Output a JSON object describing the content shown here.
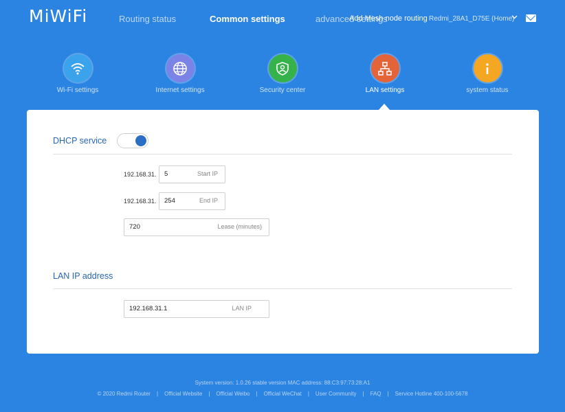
{
  "header": {
    "logo": "MiWiFi",
    "nav": {
      "routing_status": "Routing status",
      "common_settings": "Common settings",
      "advanced_settings": "advanced settings",
      "mesh": "Add Mesh node routing",
      "device": "Redmi_28A1_D75E (Home)"
    }
  },
  "features": [
    {
      "label": "Wi-Fi settings",
      "icon": "wifi-icon",
      "color": "#3aa3ec"
    },
    {
      "label": "Internet settings",
      "icon": "globe-icon",
      "color": "#7b83e6"
    },
    {
      "label": "Security center",
      "icon": "shield-icon",
      "color": "#35b34a"
    },
    {
      "label": "LAN settings",
      "icon": "network-icon",
      "color": "#e4643a"
    },
    {
      "label": "system status",
      "icon": "info-icon",
      "color": "#f5a623"
    }
  ],
  "dhcp": {
    "title": "DHCP service",
    "enabled": true,
    "prefix": "192.168.31.",
    "start_ip": {
      "value": "5",
      "placeholder": "Start IP"
    },
    "end_ip": {
      "value": "254",
      "placeholder": "End IP"
    },
    "lease": {
      "value": "720",
      "placeholder": "Lease (minutes)"
    }
  },
  "lan": {
    "title": "LAN IP address",
    "lan_ip": {
      "value": "192.168.31.1",
      "placeholder": "LAN IP"
    }
  },
  "footer": {
    "system": "System version: 1.0.26 stable version MAC address: 88:C3:97:73:28:A1",
    "links": [
      "© 2020 Redmi Router",
      "Official Website",
      "Official Weibo",
      "Official WeChat",
      "User Community",
      "FAQ",
      "Service Hotline 400-100-5678"
    ]
  },
  "colors": {
    "background": "#2b83e2",
    "accent": "#2766b5"
  }
}
